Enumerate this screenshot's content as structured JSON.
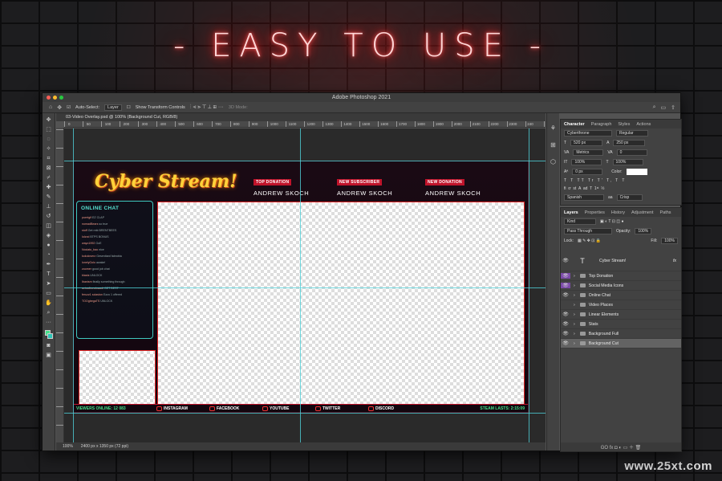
{
  "hero": {
    "neon_text": "- EASY TO USE -"
  },
  "watermark": "www.25xt.com",
  "app": {
    "title": "Adobe Photoshop 2021",
    "doc_tab": "03-Video Overlay.psd @ 100% (Background Cut, RGB/8)",
    "zoom": "100%",
    "doc_info": "2400 px x 1350 px (72 ppi)"
  },
  "options_bar": {
    "auto_select_label": "Auto-Select:",
    "auto_select_value": "Layer",
    "transform_label": "Show Transform Controls",
    "mode_3d": "3D Mode:"
  },
  "ruler": [
    "0",
    "50",
    "100",
    "200",
    "300",
    "400",
    "500",
    "600",
    "700",
    "800",
    "900",
    "1000",
    "1100",
    "1200",
    "1300",
    "1400",
    "1500",
    "1600",
    "1700",
    "1800",
    "1900",
    "2000",
    "2100",
    "2200",
    "2300",
    "240"
  ],
  "overlay": {
    "logo": "Cyber Stream!",
    "stats": [
      {
        "label": "TOP DONATION",
        "value": "ANDREW SKOCH"
      },
      {
        "label": "NEW SUBSCRIBER",
        "value": "ANDREW SKOCH"
      },
      {
        "label": "NEW DONATION",
        "value": "ANDREW SKOCH"
      }
    ],
    "chat_title": "ONLINE CHAT",
    "chat_lines": [
      {
        "user": "puertgif",
        "msg": "EZ CLAP"
      },
      {
        "user": "nomadBears",
        "msg": "so true"
      },
      {
        "user": "stuff",
        "msg": "Get rekt BRENTBEES"
      },
      {
        "user": "Iolzxd",
        "msg": "BTPS BONUS"
      },
      {
        "user": "wayo1992",
        "msg": "GoE"
      },
      {
        "user": "Nociato_bao",
        "msg": "nice"
      },
      {
        "user": "kokoloverz",
        "msg": "Gesenitard fabrobia"
      },
      {
        "user": "lonelyGolo",
        "msg": "awake!"
      },
      {
        "user": "zoomer",
        "msg": "good job chat"
      },
      {
        "user": "blasts",
        "msg": "UNLOCK"
      },
      {
        "user": "Ibanism",
        "msg": "finally something through"
      },
      {
        "user": "actualbondosauli",
        "msg": "GET BEST"
      },
      {
        "user": "feruzz1 sciaston",
        "msg": "Ezzo 1 offered"
      },
      {
        "user": "TOOgbegaTS",
        "msg": "UNLOCK"
      }
    ],
    "viewers": "VIEWERS ONLINE: 12 083",
    "socials": [
      "INSTAGRAM",
      "FACEBOOK",
      "YOUTUBE",
      "TWITTER",
      "DISCORD"
    ],
    "stream_lasts": "STEAM LASTS: 2:15:09"
  },
  "right_icons": [
    "brush-settings-icon",
    "grid-icon",
    "3d-cube-icon"
  ],
  "character_panel": {
    "tabs": [
      "Character",
      "Paragraph",
      "Styles",
      "Actions"
    ],
    "font": "Cyberthrone",
    "style": "Regular",
    "size": "520 px",
    "leading": "250 px",
    "kerning": "Metrics",
    "tracking": "0",
    "v_scale": "100%",
    "h_scale": "100%",
    "baseline": "0 px",
    "color_label": "Color:",
    "language": "Spanish",
    "aa": "Crisp",
    "tt_row": "T T TT Tr T' T, T T"
  },
  "layers_panel": {
    "tabs": [
      "Layers",
      "Properties",
      "History",
      "Adjustment",
      "Paths"
    ],
    "kind": "Kind",
    "blend": "Pass Through",
    "opacity_label": "Opacity:",
    "opacity": "100%",
    "lock_label": "Lock:",
    "fill_label": "Fill:",
    "fill": "100%",
    "text_layer": "Cyber Stream!",
    "groups": [
      {
        "name": "Top Donation",
        "purple": true,
        "selected": false
      },
      {
        "name": "Social Media Icons",
        "purple": true,
        "selected": false
      },
      {
        "name": "Online Chat",
        "purple": false,
        "selected": false
      },
      {
        "name": "Video Places",
        "purple": false,
        "selected": false
      },
      {
        "name": "Linear Elements",
        "purple": false,
        "selected": false
      },
      {
        "name": "Stats",
        "purple": false,
        "selected": false
      },
      {
        "name": "Background Full",
        "purple": false,
        "selected": false
      },
      {
        "name": "Background Cut",
        "purple": false,
        "selected": true
      }
    ],
    "footer_icons": "GO fx ◘ ◐ ▭ ＋ 🗑"
  },
  "colors": {
    "neon": "#ff2a2a",
    "accent_teal": "#3fc9c0",
    "accent_red": "#c0142b",
    "logo_yellow": "#ffd23a"
  }
}
